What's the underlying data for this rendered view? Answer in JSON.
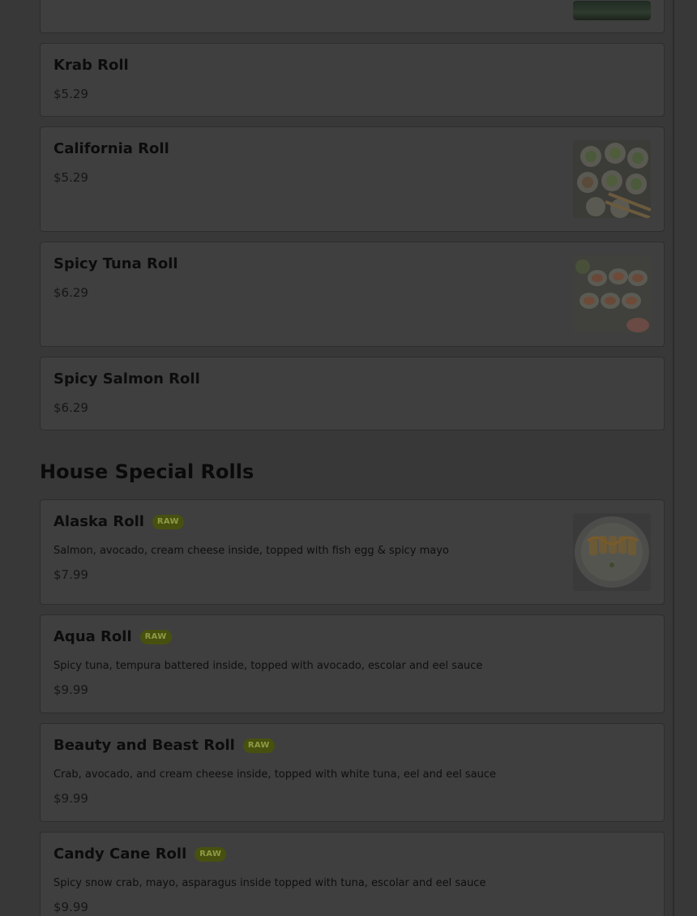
{
  "sections": [
    {
      "items": [
        {
          "name": "Krab Roll",
          "price": "$5.29"
        },
        {
          "name": "California Roll",
          "price": "$5.29"
        },
        {
          "name": "Spicy Tuna Roll",
          "price": "$6.29"
        },
        {
          "name": "Spicy Salmon Roll",
          "price": "$6.29"
        }
      ]
    },
    {
      "title": "House Special Rolls",
      "items": [
        {
          "name": "Alaska Roll",
          "badge": "RAW",
          "description": "Salmon, avocado, cream cheese inside, topped with fish egg & spicy mayo",
          "price": "$7.99"
        },
        {
          "name": "Aqua Roll",
          "badge": "RAW",
          "description": "Spicy tuna, tempura battered inside, topped with avocado, escolar and eel sauce",
          "price": "$9.99"
        },
        {
          "name": "Beauty and Beast Roll",
          "badge": "RAW",
          "description": "Crab, avocado, and cream cheese inside, topped with white tuna, eel and eel sauce",
          "price": "$9.99"
        },
        {
          "name": "Candy Cane Roll",
          "badge": "RAW",
          "description": "Spicy snow crab, mayo, asparagus inside topped with tuna, escolar and eel sauce",
          "price": "$9.99"
        }
      ]
    }
  ],
  "colors": {
    "overlay_background": "#383838",
    "card_background": "#3f3f3f",
    "raw_badge_background": "#48500f",
    "raw_badge_text": "#8e9a44"
  }
}
